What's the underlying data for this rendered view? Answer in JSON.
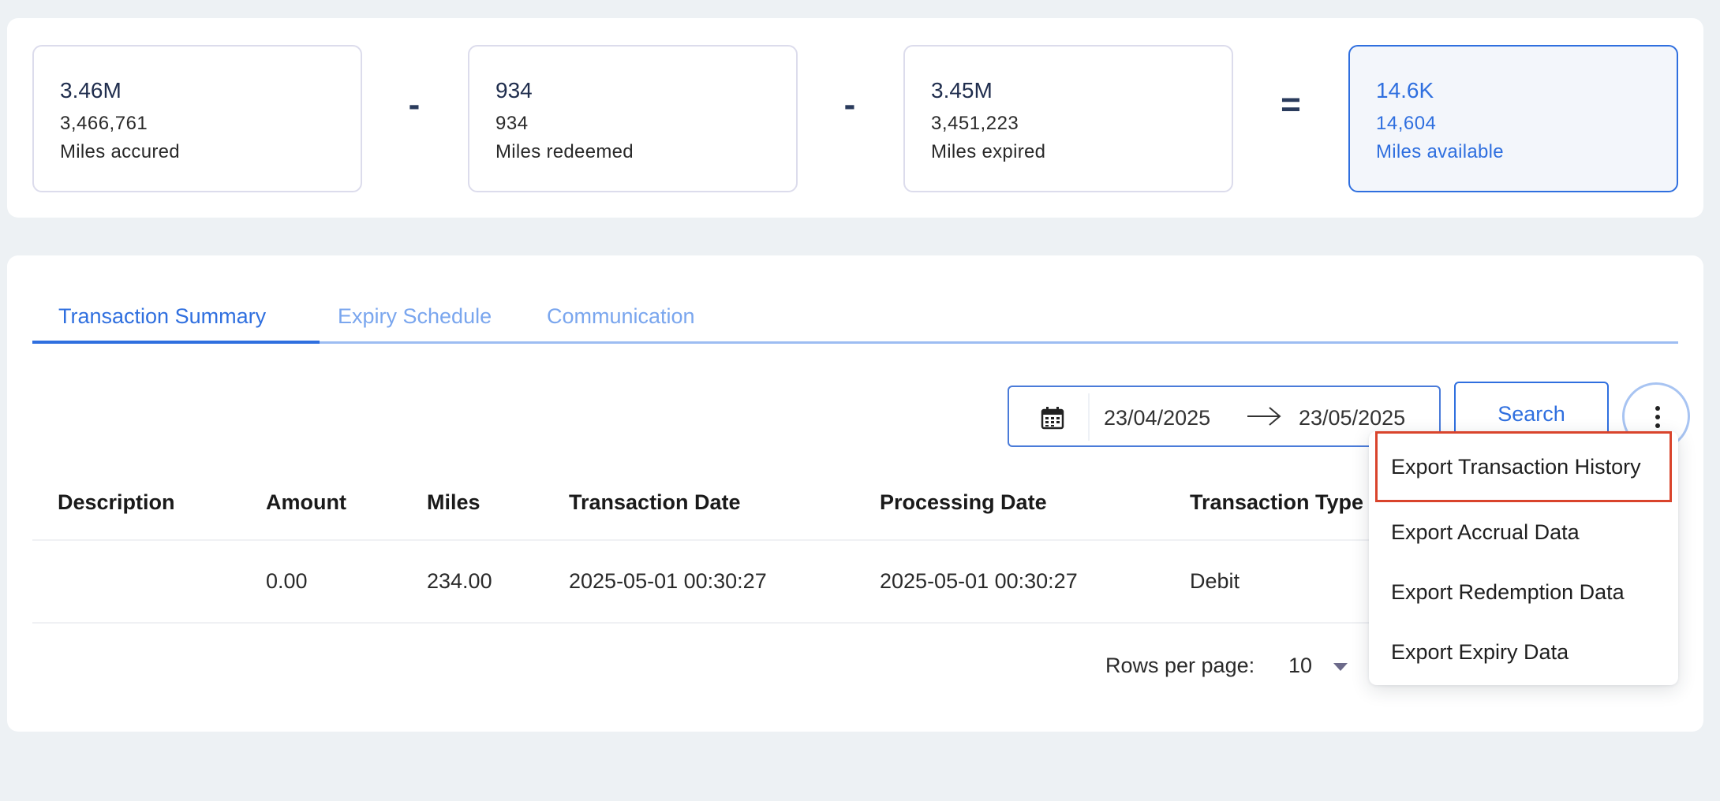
{
  "summary": {
    "accrued": {
      "big": "3.46M",
      "num": "3,466,761",
      "label": "Miles accured"
    },
    "redeemed": {
      "big": "934",
      "num": "934",
      "label": "Miles redeemed"
    },
    "expired": {
      "big": "3.45M",
      "num": "3,451,223",
      "label": "Miles expired"
    },
    "available": {
      "big": "14.6K",
      "num": "14,604",
      "label": "Miles available"
    },
    "op_minus": "-",
    "op_equals": "="
  },
  "tabs": [
    {
      "label": "Transaction Summary",
      "active": true
    },
    {
      "label": "Expiry Schedule",
      "active": false
    },
    {
      "label": "Communication",
      "active": false
    }
  ],
  "filters": {
    "start_date": "23/04/2025",
    "end_date": "23/05/2025",
    "search_label": "Search"
  },
  "table": {
    "columns": [
      "Description",
      "Amount",
      "Miles",
      "Transaction Date",
      "Processing Date",
      "Transaction Type"
    ],
    "rows": [
      [
        "",
        "0.00",
        "234.00",
        "2025-05-01 00:30:27",
        "2025-05-01 00:30:27",
        "Debit"
      ]
    ]
  },
  "pagination": {
    "rows_per_page_label": "Rows per page:",
    "rows_per_page_value": "10"
  },
  "menu": {
    "items": [
      "Export Transaction History",
      "Export Accrual Data",
      "Export Redemption Data",
      "Export Expiry Data"
    ]
  },
  "colors": {
    "accent": "#2f6fdf",
    "highlight_outline": "#d9442c",
    "background": "#edf1f4"
  }
}
